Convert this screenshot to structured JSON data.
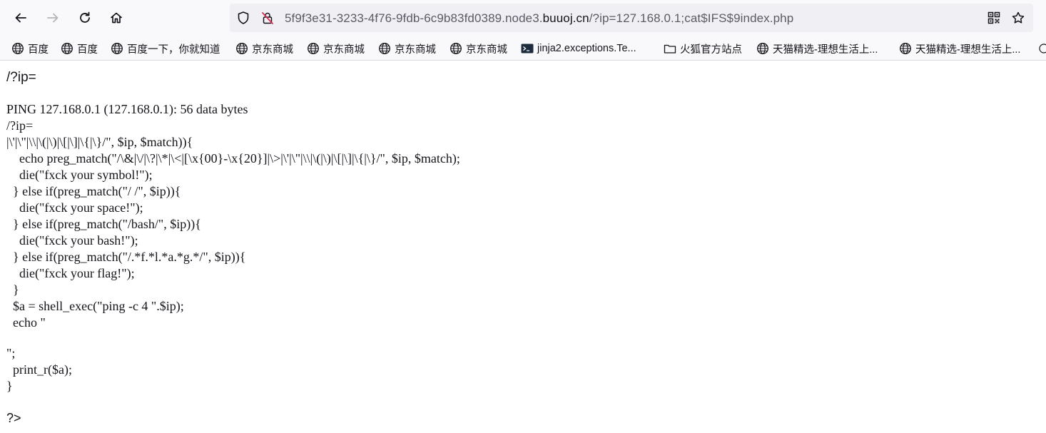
{
  "toolbar": {
    "back_icon": "arrow-left-icon",
    "forward_icon": "arrow-right-icon",
    "reload_icon": "reload-icon",
    "home_icon": "home-icon"
  },
  "urlbar": {
    "url_prefix": "5f9f3e31-3233-4f76-9fdb-6c9b83fd0389.node3.",
    "url_host": "buuoj.cn",
    "url_suffix": "/?ip=127.168.0.1;cat$IFS$9index.php",
    "shield_icon": "shield-icon",
    "insecure_icon": "insecure-lock-icon",
    "qr_icon": "qr-code-icon",
    "star_icon": "star-icon"
  },
  "bookmarks": [
    {
      "label": "百度",
      "icon": "globe-icon"
    },
    {
      "label": "百度",
      "icon": "globe-icon"
    },
    {
      "label": "百度一下，你就知道",
      "icon": "globe-icon"
    },
    {
      "label": "京东商城",
      "icon": "globe-icon"
    },
    {
      "label": "京东商城",
      "icon": "globe-icon"
    },
    {
      "label": "京东商城",
      "icon": "globe-icon"
    },
    {
      "label": "京东商城",
      "icon": "globe-icon"
    },
    {
      "label": "jinja2.exceptions.Te...",
      "icon": "terminal-icon"
    },
    {
      "label": "火狐官方站点",
      "icon": "folder-icon"
    },
    {
      "label": "天猫精选-理想生活上...",
      "icon": "globe-icon"
    },
    {
      "label": "天猫精选-理想生活上...",
      "icon": "globe-icon"
    }
  ],
  "page": {
    "heading": "/?ip=",
    "code_lines": [
      "PING 127.168.0.1 (127.168.0.1): 56 data bytes",
      "/?ip=",
      "|\\'|\\\"|\\\\|\\(|\\)|\\[|\\]|\\{|\\}/\", $ip, $match)){",
      "    echo preg_match(\"/\\&|\\/|\\?|\\*|\\<|[\\x{00}-\\x{20}]|\\>|\\'|\\\"|\\\\|\\(|\\)|\\[|\\]|\\{|\\}/\", $ip, $match);",
      "    die(\"fxck your symbol!\");",
      "  } else if(preg_match(\"/ /\", $ip)){",
      "    die(\"fxck your space!\");",
      "  } else if(preg_match(\"/bash/\", $ip)){",
      "    die(\"fxck your bash!\");",
      "  } else if(preg_match(\"/.*f.*l.*a.*g.*/\", $ip)){",
      "    die(\"fxck your flag!\");",
      "  }",
      "  $a = shell_exec(\"ping -c 4 \".$ip);",
      "  echo \""
    ],
    "code_lines_2": [
      "\";",
      "  print_r($a);",
      "}"
    ],
    "closing_tag": "?>"
  }
}
